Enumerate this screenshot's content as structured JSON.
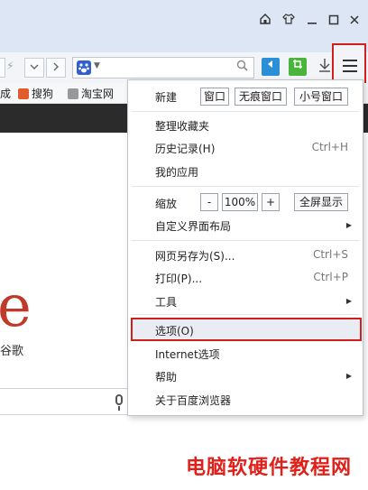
{
  "titlebar": {
    "icons": [
      "home-icon",
      "shirt-icon",
      "minimize-icon",
      "maximize-icon",
      "close-icon"
    ],
    "glyphs": [
      "⌂",
      "♔",
      "─",
      "☐",
      "✕"
    ]
  },
  "bookmarks": [
    "成",
    "搜狗",
    "淘宝网"
  ],
  "page": {
    "logo_letter": "e",
    "logo_sub": "谷歌"
  },
  "menu": {
    "new_label": "新建",
    "new_window": "窗口",
    "new_incognito": "无痕窗口",
    "new_small": "小号窗口",
    "organize_bookmarks": "整理收藏夹",
    "history": "历史记录(H)",
    "history_shortcut": "Ctrl+H",
    "my_apps": "我的应用",
    "zoom_label": "缩放",
    "zoom_minus": "-",
    "zoom_value": "100%",
    "zoom_plus": "+",
    "fullscreen": "全屏显示",
    "customize_layout": "自定义界面布局",
    "save_as": "网页另存为(S)...",
    "save_as_shortcut": "Ctrl+S",
    "print": "打印(P)...",
    "print_shortcut": "Ctrl+P",
    "tools": "工具",
    "options": "选项(O)",
    "internet_options": "Internet选项",
    "help": "帮助",
    "about": "关于百度浏览器"
  },
  "watermark": "电脑软硬件教程网",
  "colors": {
    "highlight_border": "#d0201d",
    "watermark": "#e0201a"
  }
}
